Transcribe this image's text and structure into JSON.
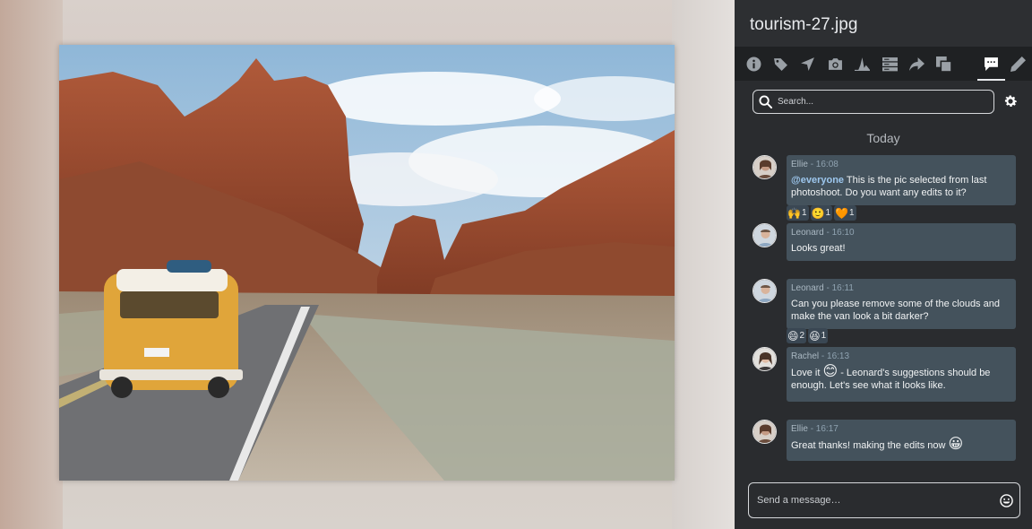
{
  "file": {
    "name": "tourism-27.jpg"
  },
  "toolbar": {
    "tabs": [
      {
        "name": "info-icon"
      },
      {
        "name": "tag-icon"
      },
      {
        "name": "location-icon"
      },
      {
        "name": "camera-icon"
      },
      {
        "name": "histogram-icon"
      },
      {
        "name": "metadata-icon"
      },
      {
        "name": "share-icon"
      },
      {
        "name": "versions-icon"
      },
      {
        "name": "comments-icon",
        "active": true
      },
      {
        "name": "edit-icon"
      }
    ]
  },
  "search": {
    "placeholder": "Search..."
  },
  "chat": {
    "day_label": "Today",
    "messages": [
      {
        "author": "Ellie",
        "time": "- 16:08",
        "mention": "@everyone",
        "text": " This is the pic selected from last photoshoot. Do you want any edits to it?",
        "reactions": [
          {
            "emoji": "🙌",
            "count": "1"
          },
          {
            "emoji": "🙂",
            "count": "1"
          },
          {
            "emoji": "🧡",
            "count": "1"
          }
        ]
      },
      {
        "author": "Leonard",
        "time": "- 16:10",
        "text": "Looks great!"
      },
      {
        "author": "Leonard",
        "time": "- 16:11",
        "text": "Can you please remove some of the clouds and make the van look a bit darker?",
        "reactions": [
          {
            "emoji": "😄",
            "count": "2"
          },
          {
            "emoji": "😆",
            "count": "1"
          }
        ]
      },
      {
        "author": "Rachel",
        "time": "- 16:13",
        "text_a": "Love it ",
        "emoji": "😊",
        "text_b": " - Leonard's suggestions should be enough. Let's see what it looks like."
      },
      {
        "author": "Ellie",
        "time": "- 16:17",
        "text": "Great thanks! making the edits now ",
        "emoji": "😀"
      }
    ]
  },
  "composer": {
    "placeholder": "Send a message…"
  },
  "colors": {
    "panel": "#2a2c2f",
    "bubble": "#44525c",
    "toolbar": "#1f2123"
  }
}
